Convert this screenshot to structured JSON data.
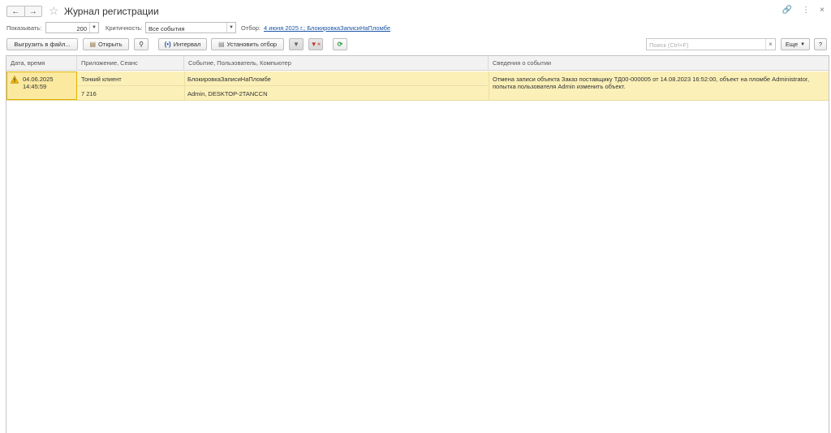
{
  "window": {
    "title": "Журнал регистрации",
    "nav_back_icon": "arrow-left-icon",
    "nav_forward_icon": "arrow-right-icon",
    "icons": [
      "link-icon",
      "more-vertical-icon",
      "close-icon"
    ]
  },
  "filters": {
    "show_label": "Показывать:",
    "show_value": "200",
    "severity_label": "Критичность:",
    "severity_value": "Все события",
    "filter_label": "Отбор:",
    "filter_link": "4 июня 2025 г.; БлокировкаЗаписиНаПломбе"
  },
  "toolbar": {
    "export_label": "Выгрузить в файл...",
    "open_label": "Открыть",
    "interval_label": "Интервал",
    "set_filter_label": "Установить отбор",
    "search_placeholder": "Поиск (Ctrl+F)",
    "more_label": "Еще",
    "help_label": "?"
  },
  "table": {
    "columns": [
      "Дата, время",
      "Приложение, Сеанс",
      "Событие, Пользователь, Компьютер",
      "Сведения о событии"
    ],
    "rows": [
      {
        "date": "04.06.2025",
        "time": "14:45:59",
        "severity_icon": "warning-icon",
        "application": "Тонкий клиент",
        "session": "7 216",
        "event": "БлокировкаЗаписиНаПломбе",
        "user_computer": "Admin, DESKTOP-2TANCCN",
        "details_line1": "Отмена записи объекта Заказ поставщику ТД00-000005 от 14.08.2023 16:52:00, объект на пломбе Administrator,",
        "details_line2": "попытка пользователя Admin изменить объект."
      }
    ]
  },
  "colors": {
    "selected_row": "#fbf0b8",
    "selected_cell_border": "#e0b100",
    "link": "#1a55a6",
    "refresh_icon": "#2e9a3c"
  }
}
